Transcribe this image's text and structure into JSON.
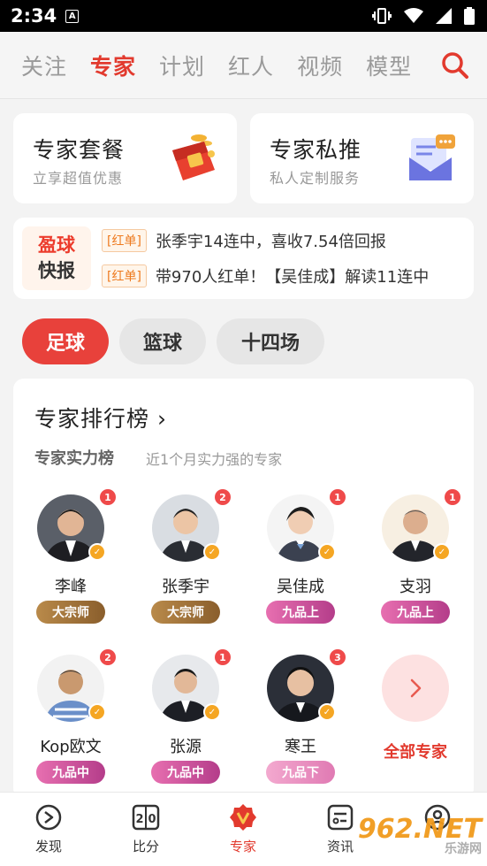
{
  "status": {
    "time": "2:34",
    "a_label": "A"
  },
  "top_tabs": [
    {
      "label": "关注",
      "active": false
    },
    {
      "label": "专家",
      "active": true
    },
    {
      "label": "计划",
      "active": false
    },
    {
      "label": "红人",
      "active": false
    },
    {
      "label": "视频",
      "active": false
    },
    {
      "label": "模型",
      "active": false
    }
  ],
  "packages": [
    {
      "title": "专家套餐",
      "subtitle": "立享超值优惠",
      "icon": "red-gift-icon"
    },
    {
      "title": "专家私推",
      "subtitle": "私人定制服务",
      "icon": "mail-message-icon"
    }
  ],
  "flash": {
    "logo_line1": "盈球",
    "logo_line2": "快报",
    "items": [
      {
        "tag": "[红单]",
        "text": "张季宇14连中，喜收7.54倍回报"
      },
      {
        "tag": "[红单]",
        "text": "带970人红单！【吴佳成】解读11连中"
      }
    ]
  },
  "sports": [
    {
      "label": "足球",
      "active": true
    },
    {
      "label": "篮球",
      "active": false
    },
    {
      "label": "十四场",
      "active": false
    }
  ],
  "ranking": {
    "title": "专家排行榜",
    "chevron": "›",
    "sub_title": "专家实力榜",
    "sub_desc": "近1个月实力强的专家",
    "experts": [
      {
        "name": "李峰",
        "badge": "1",
        "level": "大宗师",
        "level_style": "gold"
      },
      {
        "name": "张季宇",
        "badge": "2",
        "level": "大宗师",
        "level_style": "gold"
      },
      {
        "name": "吴佳成",
        "badge": "1",
        "level": "九品上",
        "level_style": "pink"
      },
      {
        "name": "支羽",
        "badge": "1",
        "level": "九品上",
        "level_style": "pink"
      },
      {
        "name": "Kop欧文",
        "badge": "2",
        "level": "九品中",
        "level_style": "pink"
      },
      {
        "name": "张源",
        "badge": "1",
        "level": "九品中",
        "level_style": "pink"
      },
      {
        "name": "寒王",
        "badge": "3",
        "level": "九品下",
        "level_style": "light"
      }
    ],
    "all_label": "全部专家"
  },
  "bottom_nav": [
    {
      "label": "发现",
      "icon": "compass-icon",
      "active": false
    },
    {
      "label": "比分",
      "icon": "scoreboard-icon",
      "active": false
    },
    {
      "label": "专家",
      "icon": "expert-badge-icon",
      "active": true
    },
    {
      "label": "资讯",
      "icon": "news-icon",
      "active": false
    },
    {
      "label": "我的",
      "icon": "profile-icon",
      "active": false
    }
  ],
  "watermark": {
    "brand": "962.NET",
    "sub": "乐游网"
  },
  "colors": {
    "accent": "#e23a2e",
    "background": "#f3f3f3"
  }
}
